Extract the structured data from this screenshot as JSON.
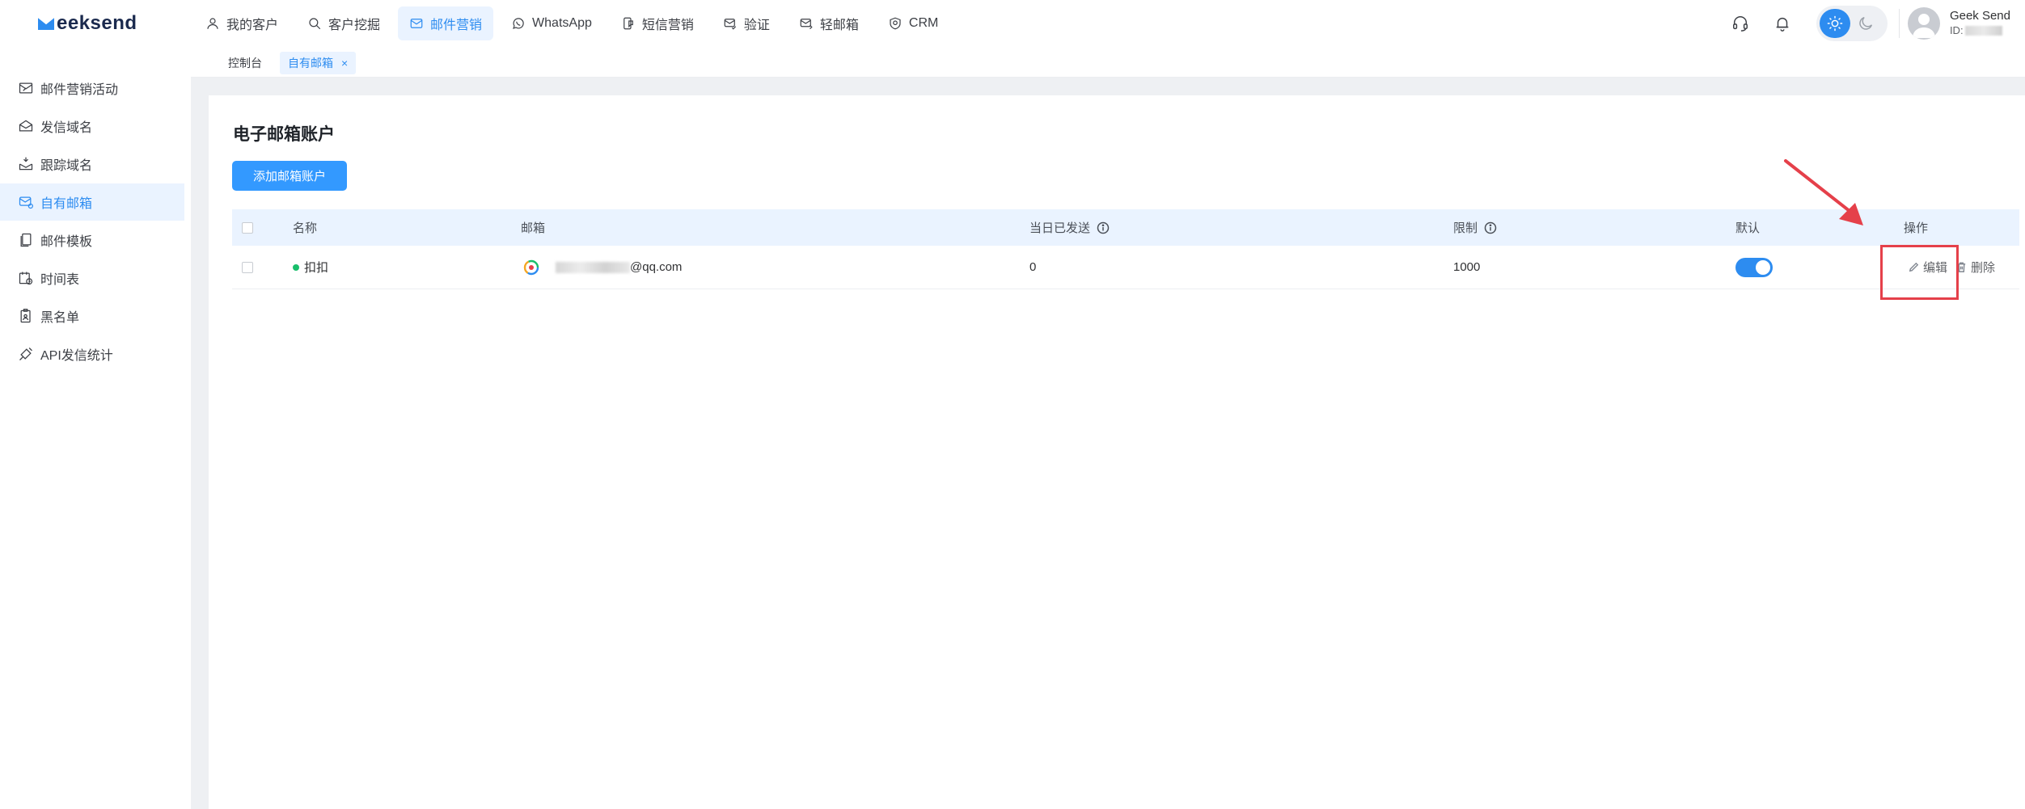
{
  "brand": {
    "logo_text": "eeksend"
  },
  "nav": {
    "items": [
      {
        "label": "我的客户",
        "icon": "user-icon"
      },
      {
        "label": "客户挖掘",
        "icon": "search-icon"
      },
      {
        "label": "邮件营销",
        "icon": "mail-icon",
        "active": true
      },
      {
        "label": "WhatsApp",
        "icon": "whatsapp-icon"
      },
      {
        "label": "短信营销",
        "icon": "sms-icon"
      },
      {
        "label": "验证",
        "icon": "verify-mail-icon"
      },
      {
        "label": "轻邮箱",
        "icon": "light-mail-icon"
      },
      {
        "label": "CRM",
        "icon": "crm-icon"
      }
    ]
  },
  "user": {
    "name": "Geek Send",
    "id_prefix": "ID:"
  },
  "tabs": [
    {
      "label": "控制台"
    },
    {
      "label": "自有邮箱",
      "active": true,
      "close": "×"
    }
  ],
  "sidebar": {
    "items": [
      {
        "label": "邮件营销活动",
        "icon": "campaign-icon"
      },
      {
        "label": "发信域名",
        "icon": "send-domain-icon"
      },
      {
        "label": "跟踪域名",
        "icon": "track-domain-icon"
      },
      {
        "label": "自有邮箱",
        "icon": "own-mailbox-icon",
        "active": true
      },
      {
        "label": "邮件模板",
        "icon": "template-icon"
      },
      {
        "label": "时间表",
        "icon": "schedule-icon"
      },
      {
        "label": "黑名单",
        "icon": "blacklist-icon"
      },
      {
        "label": "API发信统计",
        "icon": "api-stats-icon"
      }
    ]
  },
  "page": {
    "title": "电子邮箱账户",
    "add_button": "添加邮箱账户"
  },
  "table": {
    "headers": {
      "name": "名称",
      "email": "邮箱",
      "sent_today": "当日已发送",
      "limit": "限制",
      "default": "默认",
      "actions": "操作"
    },
    "rows": [
      {
        "name": "扣扣",
        "status_color": "#19be6b",
        "email_suffix": "@qq.com",
        "sent_today": "0",
        "limit": "1000",
        "default_on": true,
        "edit": "编辑",
        "delete": "删除"
      }
    ]
  },
  "colors": {
    "accent": "#2d8cf0",
    "button": "#3399ff",
    "annotation": "#e5404a"
  }
}
